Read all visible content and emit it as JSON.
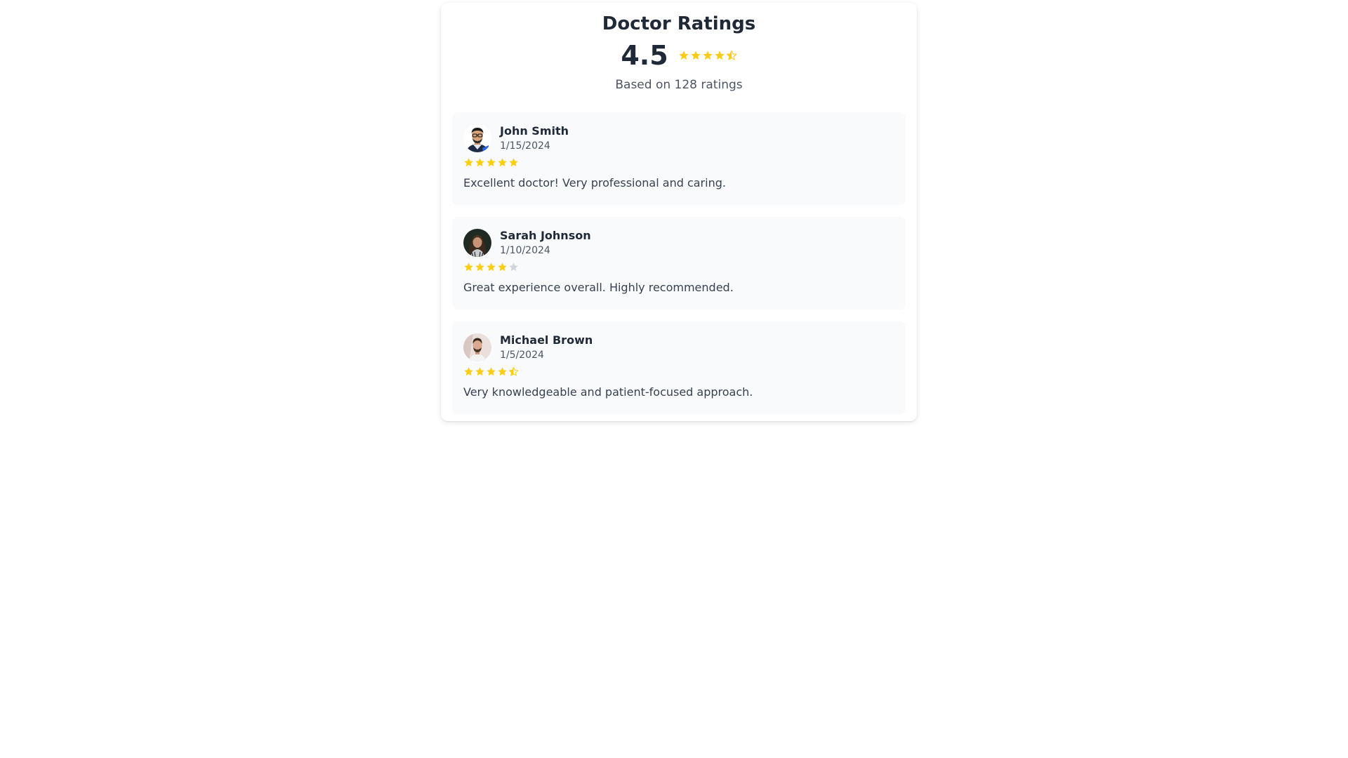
{
  "header": {
    "title": "Doctor Ratings",
    "average": "4.5",
    "average_rating": 4.5,
    "summary": "Based on 128 ratings"
  },
  "colors": {
    "star_filled": "#facc15",
    "star_empty": "#d1d5db"
  },
  "reviews": [
    {
      "name": "John Smith",
      "date": "1/15/2024",
      "rating": 5,
      "comment": "Excellent doctor! Very professional and caring.",
      "avatar_icon": "avatar-man-glasses"
    },
    {
      "name": "Sarah Johnson",
      "date": "1/10/2024",
      "rating": 4,
      "comment": "Great experience overall. Highly recommended.",
      "avatar_icon": "avatar-woman"
    },
    {
      "name": "Michael Brown",
      "date": "1/5/2024",
      "rating": 4.5,
      "comment": "Very knowledgeable and patient-focused approach.",
      "avatar_icon": "avatar-man-beard"
    }
  ]
}
